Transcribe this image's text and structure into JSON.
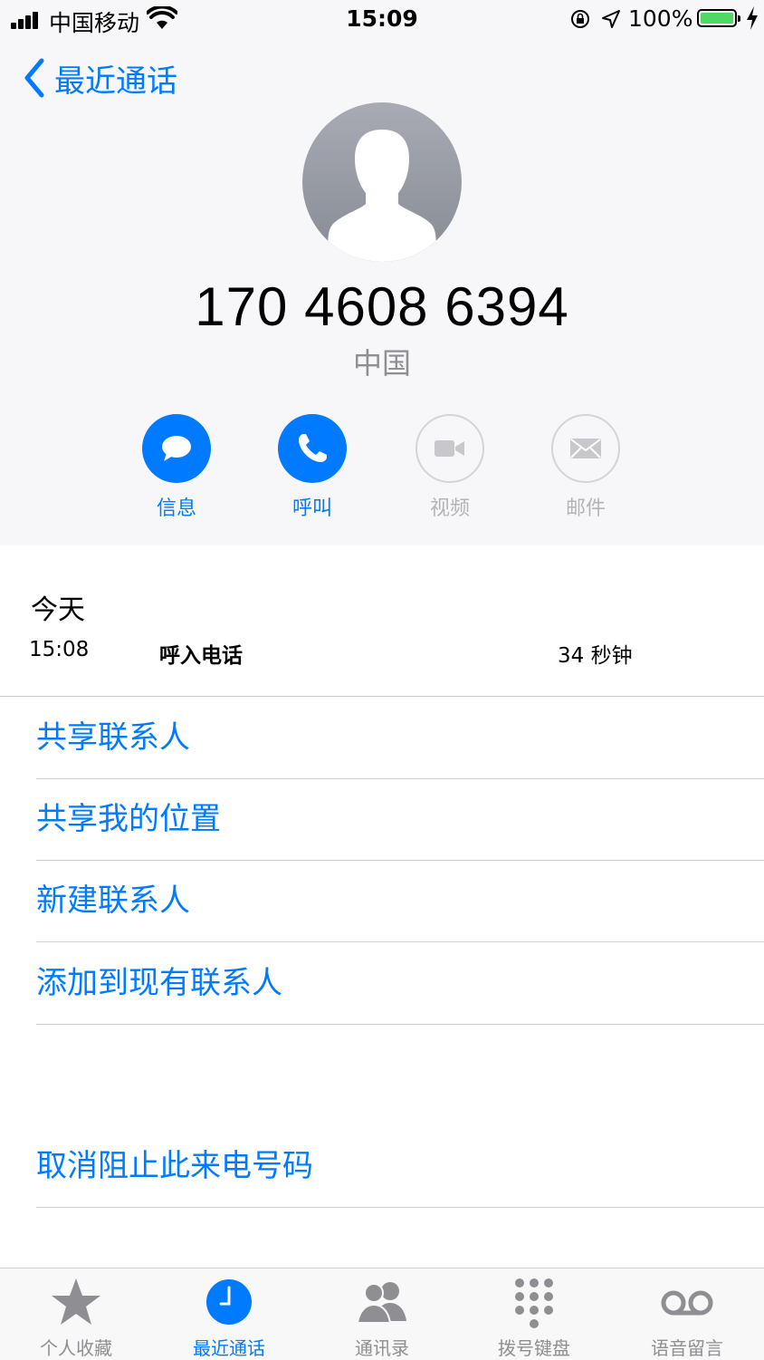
{
  "status_bar": {
    "carrier": "中国移动",
    "time": "15:09",
    "battery_percent": "100%"
  },
  "nav": {
    "back_label": "最近通话"
  },
  "contact": {
    "number": "170 4608 6394",
    "region": "中国"
  },
  "actions": [
    {
      "label": "信息",
      "icon": "message-icon",
      "enabled": true
    },
    {
      "label": "呼叫",
      "icon": "phone-icon",
      "enabled": true
    },
    {
      "label": "视频",
      "icon": "video-icon",
      "enabled": false
    },
    {
      "label": "邮件",
      "icon": "mail-icon",
      "enabled": false
    }
  ],
  "history": {
    "day": "今天",
    "entries": [
      {
        "time": "15:08",
        "type": "呼入电话",
        "duration": "34 秒钟"
      }
    ]
  },
  "menu": [
    "共享联系人",
    "共享我的位置",
    "新建联系人",
    "添加到现有联系人"
  ],
  "unblock": "取消阻止此来电号码",
  "tabs": [
    {
      "label": "个人收藏",
      "icon": "star-icon",
      "active": false
    },
    {
      "label": "最近通话",
      "icon": "clock-icon",
      "active": true
    },
    {
      "label": "通讯录",
      "icon": "contacts-icon",
      "active": false
    },
    {
      "label": "拨号键盘",
      "icon": "keypad-icon",
      "active": false
    },
    {
      "label": "语音留言",
      "icon": "voicemail-icon",
      "active": false
    }
  ],
  "colors": {
    "accent": "#007aff",
    "disabled": "#b4b4b8",
    "battery": "#4cd964"
  }
}
